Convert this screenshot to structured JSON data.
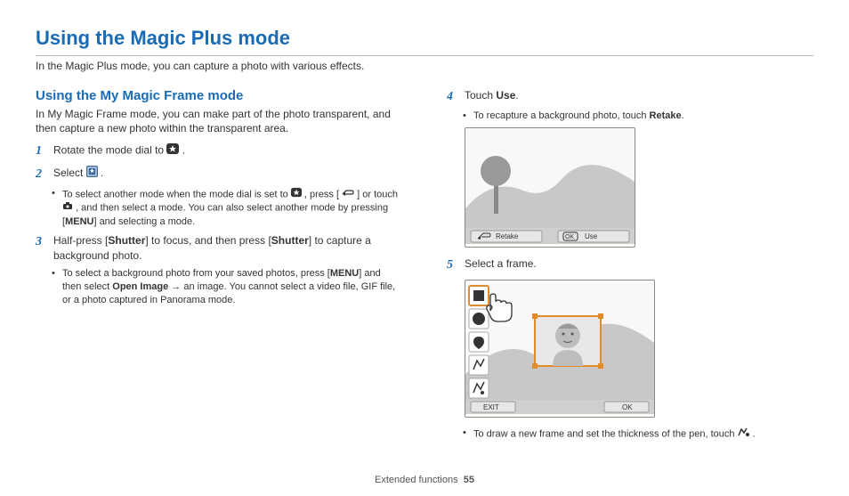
{
  "title": "Using the Magic Plus mode",
  "intro": "In the Magic Plus mode, you can capture a photo with various effects.",
  "section_title": "Using the My Magic Frame mode",
  "section_intro": "In My Magic Frame mode, you can make part of the photo transparent, and then capture a new photo within the transparent area.",
  "steps": {
    "s1": {
      "num": "1",
      "pre": "Rotate the mode dial to ",
      "post": "."
    },
    "s2": {
      "num": "2",
      "pre": "Select ",
      "post": "."
    },
    "s2b_a": "To select another mode when the mode dial is set to ",
    "s2b_b": ", press [",
    "s2b_c": "] or touch ",
    "s2b_d": ", and then select a mode. You can also select another mode by pressing [",
    "s2b_menu": "MENU",
    "s2b_e": "] and selecting a mode.",
    "s3": {
      "num": "3",
      "a": "Half-press [",
      "shutter": "Shutter",
      "b": "] to focus, and then press [",
      "c": "] to capture a background photo."
    },
    "s3b_a": "To select a background photo from your saved photos, press [",
    "s3b_menu": "MENU",
    "s3b_b": "] and then select ",
    "s3b_open": "Open Image",
    "s3b_c": " → an image. You cannot select a video file, GIF file, or a photo captured in Panorama mode.",
    "s4": {
      "num": "4",
      "a": "Touch ",
      "use": "Use",
      "b": "."
    },
    "s4b_a": "To recapture a background photo, touch ",
    "s4b_retake": "Retake",
    "s4b_b": ".",
    "s5": {
      "num": "5",
      "text": "Select a frame."
    },
    "s5b_a": "To draw a new frame and set the thickness of the pen, touch ",
    "s5b_b": "."
  },
  "screenshot1": {
    "retake_icon_label": "Retake",
    "ok": "OK",
    "use": "Use"
  },
  "screenshot2": {
    "exit": "EXIT",
    "ok": "OK"
  },
  "footer": {
    "section": "Extended functions",
    "page": "55"
  }
}
